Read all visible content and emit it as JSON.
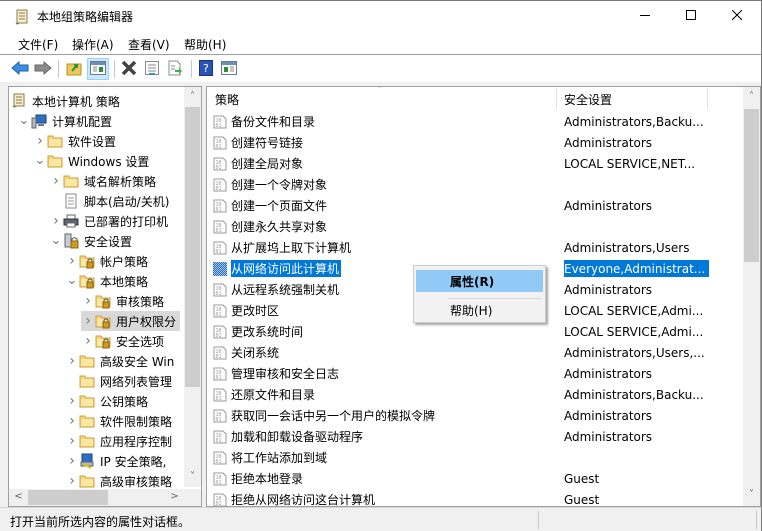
{
  "window": {
    "title": "本地组策略编辑器",
    "icon": "scroll-policy-icon",
    "controls": {
      "minimize": "minimize-icon",
      "maximize": "maximize-icon",
      "close": "close-icon"
    }
  },
  "menubar": {
    "items": [
      {
        "label": "文件(F)"
      },
      {
        "label": "操作(A)"
      },
      {
        "label": "查看(V)"
      },
      {
        "label": "帮助(H)"
      }
    ]
  },
  "toolbar": {
    "buttons": [
      {
        "name": "back",
        "icon": "back-arrow-icon"
      },
      {
        "name": "forward",
        "icon": "forward-arrow-icon"
      },
      {
        "name": "up-folder",
        "icon": "up-folder-icon"
      },
      {
        "name": "show-hide-tree",
        "icon": "console-tree-icon",
        "active": true
      },
      {
        "name": "delete",
        "icon": "delete-x-icon"
      },
      {
        "name": "properties",
        "icon": "properties-icon"
      },
      {
        "name": "export-list",
        "icon": "export-list-icon"
      },
      {
        "name": "help",
        "icon": "help-icon"
      },
      {
        "name": "show-action-pane",
        "icon": "action-pane-icon"
      }
    ]
  },
  "tree": {
    "items": [
      {
        "label": "本地计算机 策略",
        "level": 0,
        "expander": "none",
        "icon": "policy-scroll-icon"
      },
      {
        "label": "计算机配置",
        "level": 1,
        "expander": "expanded",
        "icon": "computer-icon"
      },
      {
        "label": "软件设置",
        "level": 2,
        "expander": "collapsed",
        "icon": "folder-icon"
      },
      {
        "label": "Windows 设置",
        "level": 2,
        "expander": "expanded",
        "icon": "folder-icon"
      },
      {
        "label": "域名解析策略",
        "level": 3,
        "expander": "collapsed",
        "icon": "folder-icon"
      },
      {
        "label": "脚本(启动/关机)",
        "level": 3,
        "expander": "none",
        "icon": "script-icon"
      },
      {
        "label": "已部署的打印机",
        "level": 3,
        "expander": "collapsed",
        "icon": "printer-icon"
      },
      {
        "label": "安全设置",
        "level": 3,
        "expander": "expanded",
        "icon": "security-settings-icon"
      },
      {
        "label": "帐户策略",
        "level": 4,
        "expander": "collapsed",
        "icon": "locked-folder-icon"
      },
      {
        "label": "本地策略",
        "level": 4,
        "expander": "expanded",
        "icon": "locked-folder-icon"
      },
      {
        "label": "审核策略",
        "level": 5,
        "expander": "collapsed",
        "icon": "locked-folder-icon"
      },
      {
        "label": "用户权限分",
        "level": 5,
        "expander": "collapsed",
        "icon": "locked-folder-icon",
        "selected": true
      },
      {
        "label": "安全选项",
        "level": 5,
        "expander": "collapsed",
        "icon": "locked-folder-icon"
      },
      {
        "label": "高级安全 Win",
        "level": 4,
        "expander": "collapsed",
        "icon": "folder-icon"
      },
      {
        "label": "网络列表管理",
        "level": 4,
        "expander": "none",
        "icon": "folder-icon"
      },
      {
        "label": "公钥策略",
        "level": 4,
        "expander": "collapsed",
        "icon": "folder-icon"
      },
      {
        "label": "软件限制策略",
        "level": 4,
        "expander": "collapsed",
        "icon": "folder-icon"
      },
      {
        "label": "应用程序控制",
        "level": 4,
        "expander": "collapsed",
        "icon": "folder-icon"
      },
      {
        "label": "IP 安全策略,",
        "level": 4,
        "expander": "collapsed",
        "icon": "ip-security-icon"
      },
      {
        "label": "高级审核策略",
        "level": 4,
        "expander": "collapsed",
        "icon": "folder-icon"
      }
    ]
  },
  "list": {
    "columns": [
      {
        "label": "策略"
      },
      {
        "label": "安全设置"
      }
    ],
    "rows": [
      {
        "policy": "备份文件和目录",
        "setting": "Administrators,Backu..."
      },
      {
        "policy": "创建符号链接",
        "setting": "Administrators"
      },
      {
        "policy": "创建全局对象",
        "setting": "LOCAL SERVICE,NET..."
      },
      {
        "policy": "创建一个令牌对象",
        "setting": ""
      },
      {
        "policy": "创建一个页面文件",
        "setting": "Administrators"
      },
      {
        "policy": "创建永久共享对象",
        "setting": ""
      },
      {
        "policy": "从扩展坞上取下计算机",
        "setting": "Administrators,Users"
      },
      {
        "policy": "从网络访问此计算机",
        "setting": "Everyone,Administrat...",
        "selected": true
      },
      {
        "policy": "从远程系统强制关机",
        "setting": "Administrators"
      },
      {
        "policy": "更改时区",
        "setting": "LOCAL SERVICE,Admi..."
      },
      {
        "policy": "更改系统时间",
        "setting": "LOCAL SERVICE,Admi..."
      },
      {
        "policy": "关闭系统",
        "setting": "Administrators,Users,..."
      },
      {
        "policy": "管理审核和安全日志",
        "setting": "Administrators"
      },
      {
        "policy": "还原文件和目录",
        "setting": "Administrators,Backu..."
      },
      {
        "policy": "获取同一会话中另一个用户的模拟令牌",
        "setting": "Administrators"
      },
      {
        "policy": "加载和卸载设备驱动程序",
        "setting": "Administrators"
      },
      {
        "policy": "将工作站添加到域",
        "setting": ""
      },
      {
        "policy": "拒绝本地登录",
        "setting": "Guest"
      },
      {
        "policy": "拒绝从网络访问这台计算机",
        "setting": "Guest"
      }
    ]
  },
  "context_menu": {
    "items": [
      {
        "label": "属性(R)",
        "highlighted": true
      },
      {
        "label": "帮助(H)"
      }
    ]
  },
  "statusbar": {
    "text": "打开当前所选内容的属性对话框。"
  },
  "colors": {
    "selection": "#0078d7",
    "menu_highlight": "#91c9f7",
    "tree_selection": "#d9d9d9"
  }
}
